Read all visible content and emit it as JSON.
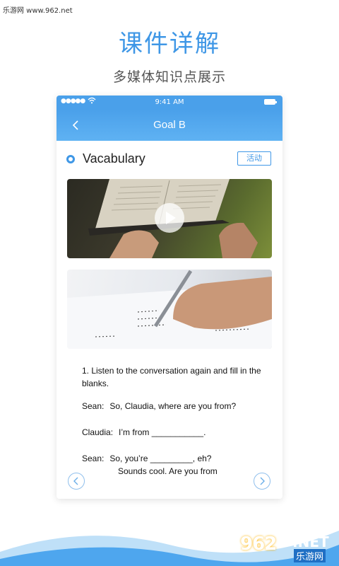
{
  "watermark": "乐游网 www.962.net",
  "headline": "课件详解",
  "subheadline": "多媒体知识点展示",
  "statusbar": {
    "signal": "●●●●●",
    "time": "9:41 AM"
  },
  "nav": {
    "title": "Goal B"
  },
  "section": {
    "title": "Vacabulary",
    "activity_label": "活动"
  },
  "exercise": {
    "instruction": "1. Listen to the conversation again and fill in the blanks.",
    "lines": [
      {
        "speaker": "Sean:",
        "text": "So, Claudia, where are you from?"
      },
      {
        "speaker": "Claudia:",
        "text": "I’m from ___________."
      },
      {
        "speaker": "Sean:",
        "text": "So, you’re _________, eh?"
      }
    ],
    "continuation": "Sounds cool. Are you from"
  },
  "logo": {
    "number": "962",
    "suffix": ".NET",
    "site": "乐游网"
  },
  "colors": {
    "accent": "#3f97e6",
    "nav_bg": "#4aa0ea"
  },
  "icons": [
    "wifi-icon",
    "battery-icon",
    "back-icon",
    "bullet-icon",
    "play-icon",
    "prev-arrow-icon",
    "next-arrow-icon"
  ]
}
